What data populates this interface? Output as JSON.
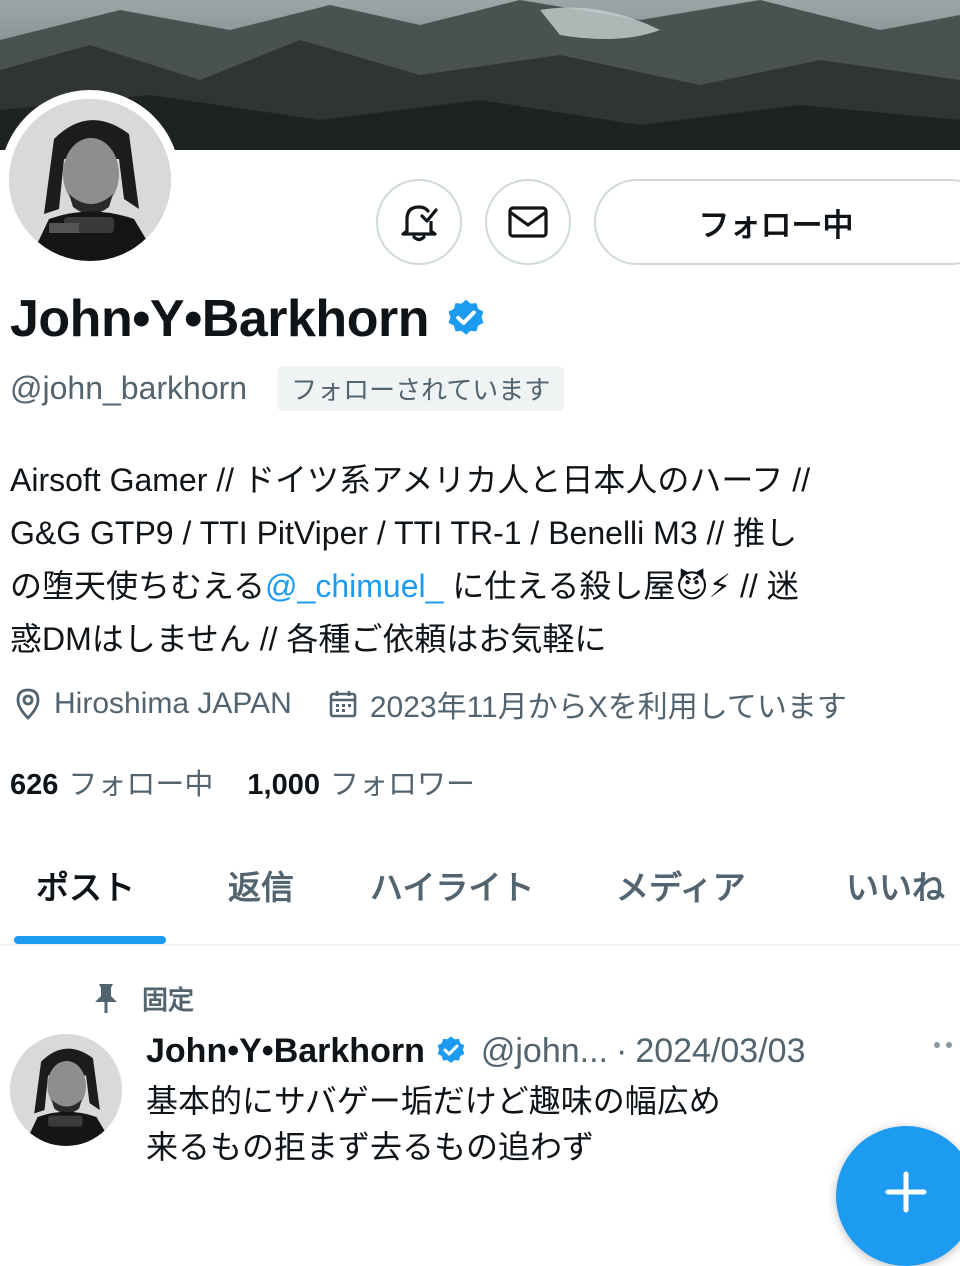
{
  "profile": {
    "banner_icon": "mountain-landscape-photo",
    "avatar_icon": "profile-photo",
    "display_name": "John•Y•Barkhorn",
    "handle": "@john_barkhorn",
    "follows_you": "フォローされています",
    "verified_icon": "verified-badge-icon",
    "bio_lines": [
      "Airsoft Gamer // ドイツ系アメリカ人と日本人のハーフ //",
      "G&G GTP9 / TTI PitViper / TTI TR-1 / Benelli M3 // 推し",
      "の堕天使ちむえる",
      "@_chimuel_",
      " に仕える殺し屋😈⚡ // 迷",
      "惑DMはしません // 各種ご依頼はお気軽に"
    ],
    "location": "Hiroshima JAPAN",
    "joined": "2023年11月からXを利用しています",
    "following_count": "626",
    "following_label": "フォロー中",
    "followers_count": "1,000",
    "followers_label": "フォロワー"
  },
  "actions": {
    "notify_icon": "bell-check-icon",
    "message_icon": "envelope-icon",
    "follow_label": "フォロー中"
  },
  "tabs": [
    "ポスト",
    "返信",
    "ハイライト",
    "メディア",
    "いいね"
  ],
  "active_tab": "ポスト",
  "pinned_post": {
    "pinned_label": "固定",
    "author_name": "John•Y•Barkhorn",
    "author_handle": "@john...",
    "separator": "·",
    "date": "2024/03/03",
    "text_lines": [
      "基本的にサバゲー垢だけど趣味の幅広め",
      "来るもの拒まず去るもの追わず"
    ]
  },
  "colors": {
    "accent": "#1d9bf0",
    "text": "#0f1419",
    "secondary": "#536471"
  }
}
